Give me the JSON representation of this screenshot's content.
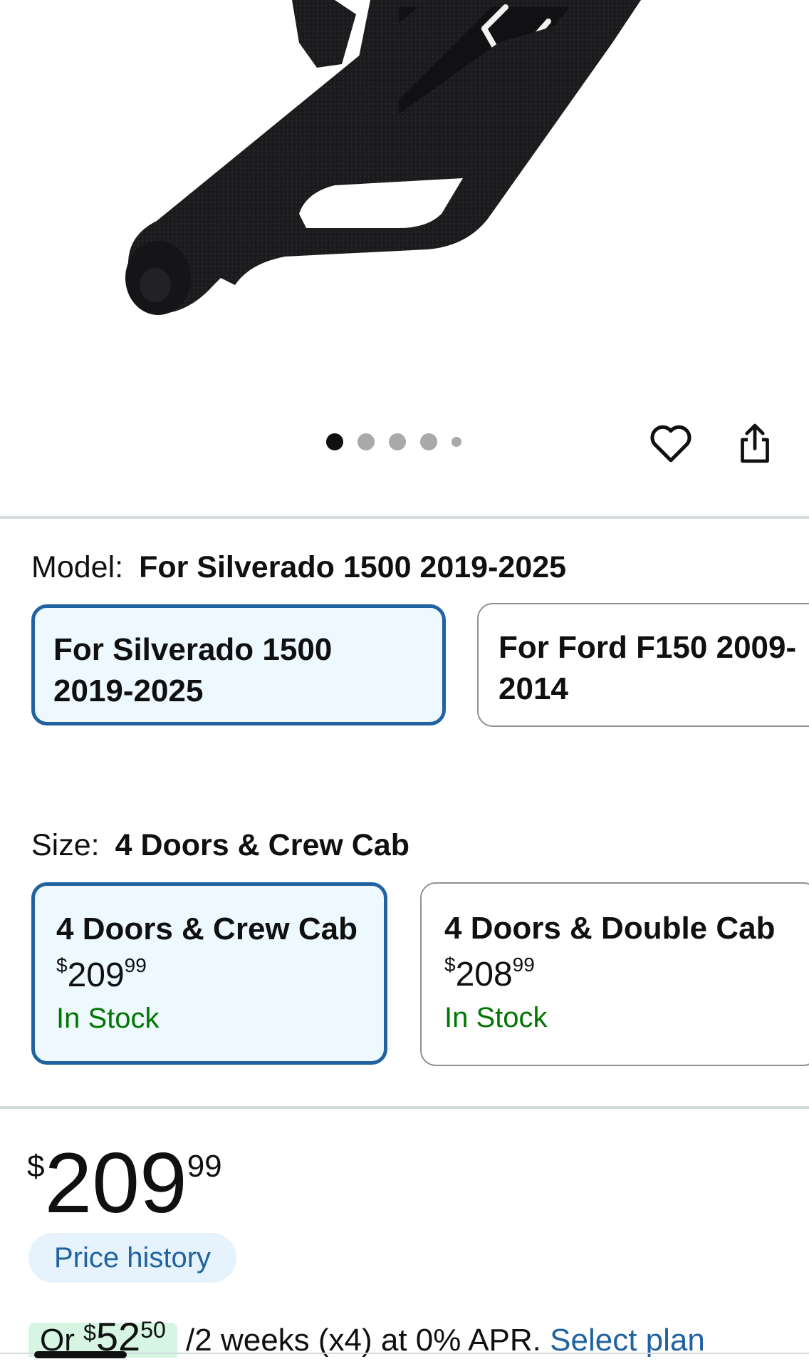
{
  "gallery": {
    "image_alt": "Black textured nerf bar running board",
    "dots_count": 5,
    "active_dot": 1
  },
  "actions": {
    "favorite_icon": "heart-icon",
    "share_icon": "share-icon"
  },
  "model": {
    "label": "Model:",
    "selected_value": "For Silverado 1500 2019-2025",
    "options": [
      {
        "line1": "For Silverado 1500",
        "line2": "2019-2025",
        "selected": true
      },
      {
        "line1": "For Ford F150 2009-",
        "line2": "2014",
        "selected": false
      }
    ]
  },
  "size": {
    "label": "Size:",
    "selected_value": "4 Doors & Crew Cab",
    "options": [
      {
        "name": "4 Doors & Crew Cab",
        "currency": "$",
        "whole": "209",
        "fraction": "99",
        "stock": "In Stock",
        "selected": true
      },
      {
        "name": "4 Doors & Double Cab",
        "currency": "$",
        "whole": "208",
        "fraction": "99",
        "stock": "In Stock",
        "selected": false
      }
    ]
  },
  "price": {
    "currency": "$",
    "whole": "209",
    "fraction": "99",
    "history_label": "Price history"
  },
  "installment": {
    "prefix": "Or ",
    "currency": "$",
    "whole": "52",
    "fraction": "50",
    "terms": " /2 weeks (x4) at 0% APR. ",
    "link": "Select plan"
  },
  "colors": {
    "accent_blue": "#2162a1",
    "selected_bg": "#edf8ff",
    "stock_green": "#007600",
    "history_bg": "#e6f3fc",
    "installment_bg": "#d6f5e3"
  }
}
